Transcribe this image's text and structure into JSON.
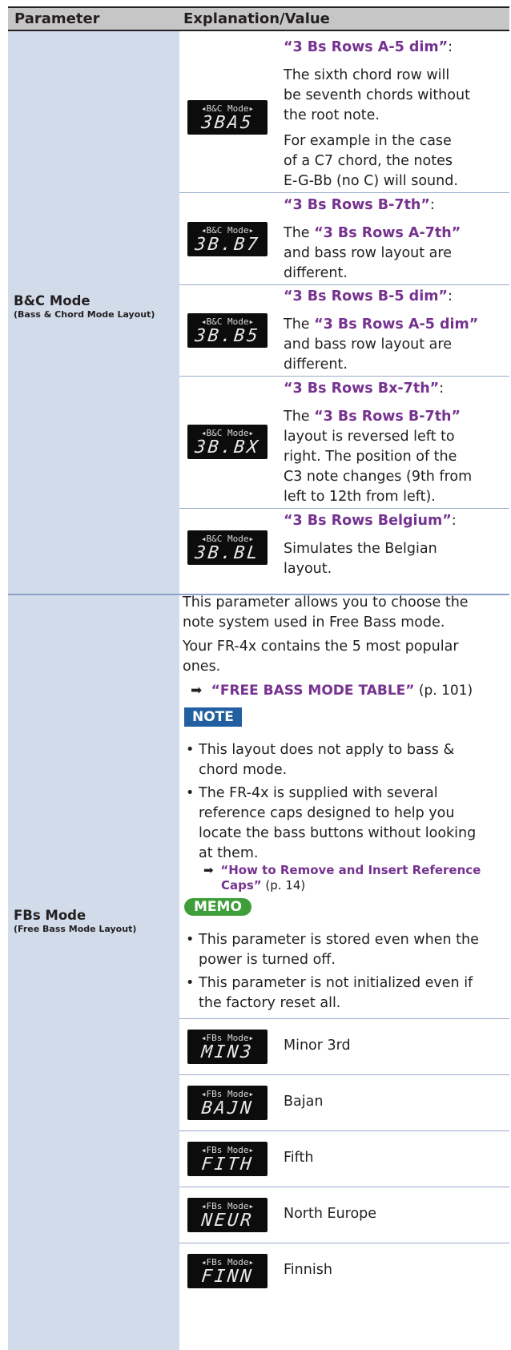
{
  "header": {
    "col_param": "Parameter",
    "col_expl": "Explanation/Value"
  },
  "bc_mode": {
    "name": "B&C Mode",
    "sub": "(Bass & Chord Mode Layout)",
    "rows": [
      {
        "lcd_top": "◂B&C Mode▸",
        "lcd_main": "3BA5",
        "title": "“3 Bs Rows A-5 dim”",
        "colon": ":",
        "lines": [
          "The sixth chord row will",
          "be seventh chords without",
          "the root note."
        ],
        "lines2": [
          "For example in the case",
          "of a C7 chord, the notes",
          "E-G-Bb (no C) will sound."
        ]
      },
      {
        "lcd_top": "◂B&C Mode▸",
        "lcd_main": "3B.B7",
        "title": "“3 Bs Rows B-7th”",
        "colon": ":",
        "pre": "The ",
        "ref": "“3 Bs Rows A-7th”",
        "lines": [
          "and bass row layout are",
          "different."
        ]
      },
      {
        "lcd_top": "◂B&C Mode▸",
        "lcd_main": "3B.B5",
        "title": "“3 Bs Rows B-5 dim”",
        "colon": ":",
        "pre": "The ",
        "ref": "“3 Bs Rows A-5 dim”",
        "lines": [
          "and bass row layout are",
          "different."
        ]
      },
      {
        "lcd_top": "◂B&C Mode▸",
        "lcd_main": "3B.BX",
        "title": "“3 Bs Rows Bx-7th”",
        "colon": ":",
        "pre": "The ",
        "ref": "“3 Bs Rows B-7th”",
        "lines": [
          "layout is reversed left to",
          "right. The position of the",
          "C3 note changes (9th from",
          "left to 12th from left)."
        ]
      },
      {
        "lcd_top": "◂B&C Mode▸",
        "lcd_main": "3B.BL",
        "title": "“3 Bs Rows Belgium”",
        "colon": ":",
        "lines": [
          "Simulates the Belgian",
          "layout."
        ]
      }
    ]
  },
  "fbs_mode": {
    "name": "FBs Mode",
    "sub": "(Free Bass Mode Layout)",
    "intro": [
      "This parameter allows you to choose the",
      "note system used in Free Bass mode."
    ],
    "intro2": [
      "Your FR-4x contains the 5 most popular",
      "ones."
    ],
    "link": {
      "arrow": "➡",
      "text": "“FREE BASS MODE TABLE”",
      "page": " (p. 101)"
    },
    "note_label": "NOTE",
    "note_bullets": [
      [
        "This layout does not apply to bass &",
        "chord mode."
      ],
      [
        "The FR-4x is supplied with several",
        "reference caps designed to help you",
        "locate the bass buttons without looking",
        "at them."
      ]
    ],
    "note_link": {
      "arrow": "➡",
      "text1": "“How to Remove and Insert Reference",
      "text2": "Caps”",
      "page": " (p. 14)"
    },
    "memo_label": "MEMO",
    "memo_bullets": [
      [
        "This parameter is stored even when the",
        "power is turned off."
      ],
      [
        "This parameter is not initialized even if",
        "the factory reset all."
      ]
    ],
    "values": [
      {
        "lcd_top": "◂FBs Mode▸",
        "lcd_main": "MIN3",
        "label": "Minor 3rd"
      },
      {
        "lcd_top": "◂FBs Mode▸",
        "lcd_main": "BAJN",
        "label": "Bajan"
      },
      {
        "lcd_top": "◂FBs Mode▸",
        "lcd_main": "FITH",
        "label": "Fifth"
      },
      {
        "lcd_top": "◂FBs Mode▸",
        "lcd_main": "NEUR",
        "label": "North Europe"
      },
      {
        "lcd_top": "◂FBs Mode▸",
        "lcd_main": "FINN",
        "label": "Finnish"
      }
    ]
  }
}
